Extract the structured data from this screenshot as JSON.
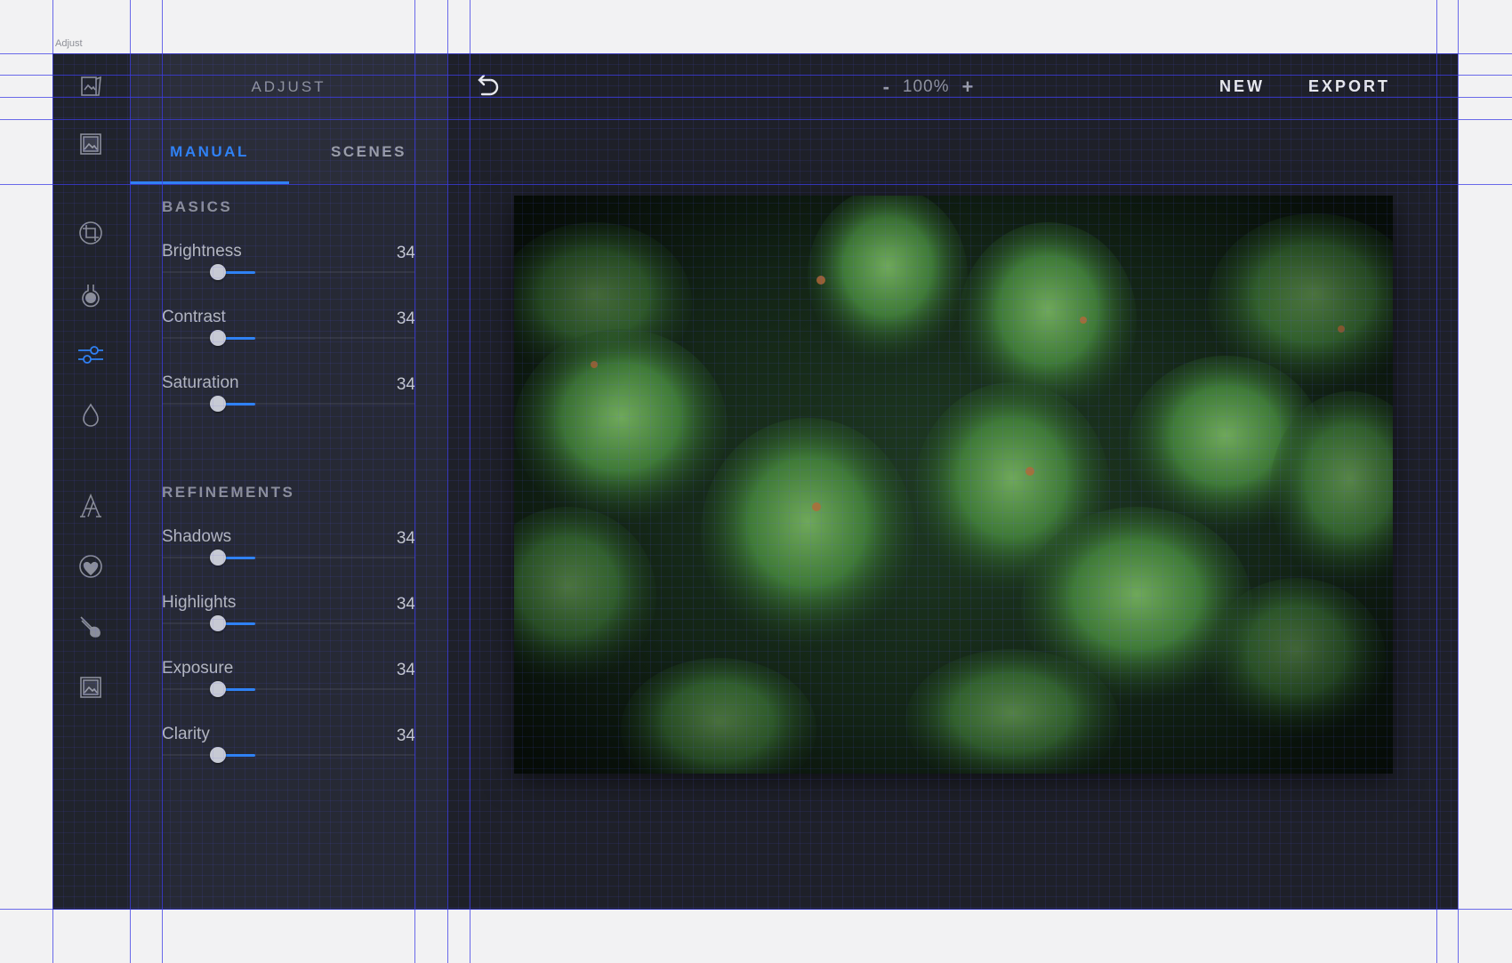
{
  "frame_label": "Adjust",
  "rail": {
    "tools": [
      {
        "name": "layers-icon"
      },
      {
        "name": "image-icon"
      },
      {
        "name": "crop-icon"
      },
      {
        "name": "filter-icon"
      },
      {
        "name": "adjust-sliders-icon",
        "active": true
      },
      {
        "name": "drop-icon"
      },
      {
        "name": "text-icon"
      },
      {
        "name": "sticker-icon"
      },
      {
        "name": "brush-icon"
      },
      {
        "name": "frame-icon"
      }
    ]
  },
  "panel": {
    "title": "ADJUST",
    "tabs": [
      {
        "label": "MANUAL",
        "active": true
      },
      {
        "label": "SCENES",
        "active": false
      }
    ],
    "basics_title": "BASICS",
    "refinements_title": "REFINEMENTS",
    "basics": [
      {
        "label": "Brightness",
        "value": "34"
      },
      {
        "label": "Contrast",
        "value": "34"
      },
      {
        "label": "Saturation",
        "value": "34"
      }
    ],
    "refinements": [
      {
        "label": "Shadows",
        "value": "34"
      },
      {
        "label": "Highlights",
        "value": "34"
      },
      {
        "label": "Exposure",
        "value": "34"
      },
      {
        "label": "Clarity",
        "value": "34"
      }
    ]
  },
  "topbar": {
    "zoom_minus": "-",
    "zoom_level": "100%",
    "zoom_plus": "+",
    "new_label": "NEW",
    "export_label": "EXPORT"
  },
  "colors": {
    "accent": "#2f82f4",
    "app_bg": "#1e2029",
    "panel_bg": "#262935"
  }
}
